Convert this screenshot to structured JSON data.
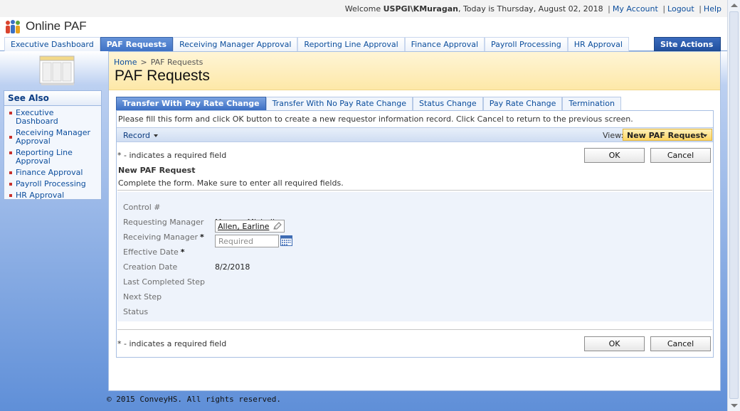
{
  "topbar": {
    "welcome_prefix": "Welcome ",
    "user": "USPGI\\KMuragan",
    "date_text": ", Today is Thursday, August 02, 2018",
    "links": [
      "My Account",
      "Logout",
      "Help"
    ]
  },
  "site": {
    "title": "Online PAF"
  },
  "nav": {
    "tabs": [
      "Executive Dashboard",
      "PAF Requests",
      "Receiving Manager Approval",
      "Reporting Line Approval",
      "Finance Approval",
      "Payroll Processing",
      "HR Approval"
    ],
    "active": "PAF Requests",
    "site_actions": "Site Actions"
  },
  "see_also": {
    "title": "See Also",
    "items": [
      "Executive Dashboard",
      "Receiving Manager Approval",
      "Reporting Line Approval",
      "Finance Approval",
      "Payroll Processing",
      "HR Approval"
    ]
  },
  "breadcrumb": {
    "home": "Home",
    "sep": ">",
    "current": "PAF Requests"
  },
  "page_title": "PAF Requests",
  "form_tabs": {
    "items": [
      "Transfer With Pay Rate Change",
      "Transfer With No Pay Rate Change",
      "Status Change",
      "Pay Rate Change",
      "Termination"
    ],
    "active": "Transfer With Pay Rate Change"
  },
  "instructions": "Please fill this form and click OK button to create a new requestor information record. Click Cancel to return to the previous screen.",
  "toolbar": {
    "record": "Record",
    "view_label": "View:",
    "view_value": "New PAF Request"
  },
  "form": {
    "required_note": "* - indicates a required field",
    "heading": "New PAF Request",
    "description": "Complete the form. Make sure to enter all required fields.",
    "ok": "OK",
    "cancel": "Cancel",
    "star": "*",
    "fields": {
      "control_label": "Control #",
      "requesting_manager_label": "Requesting Manager",
      "requesting_manager_value": "Murray, Michelle",
      "receiving_manager_label": "Receiving Manager",
      "receiving_manager_value": "Allen, Earline",
      "effective_date_label": "Effective Date",
      "effective_date_placeholder": "Required",
      "creation_date_label": "Creation Date",
      "creation_date_value": "8/2/2018",
      "last_step_label": "Last Completed Step",
      "next_step_label": "Next Step",
      "status_label": "Status"
    }
  },
  "footer": "© 2015 ConveyHS. All rights reserved."
}
